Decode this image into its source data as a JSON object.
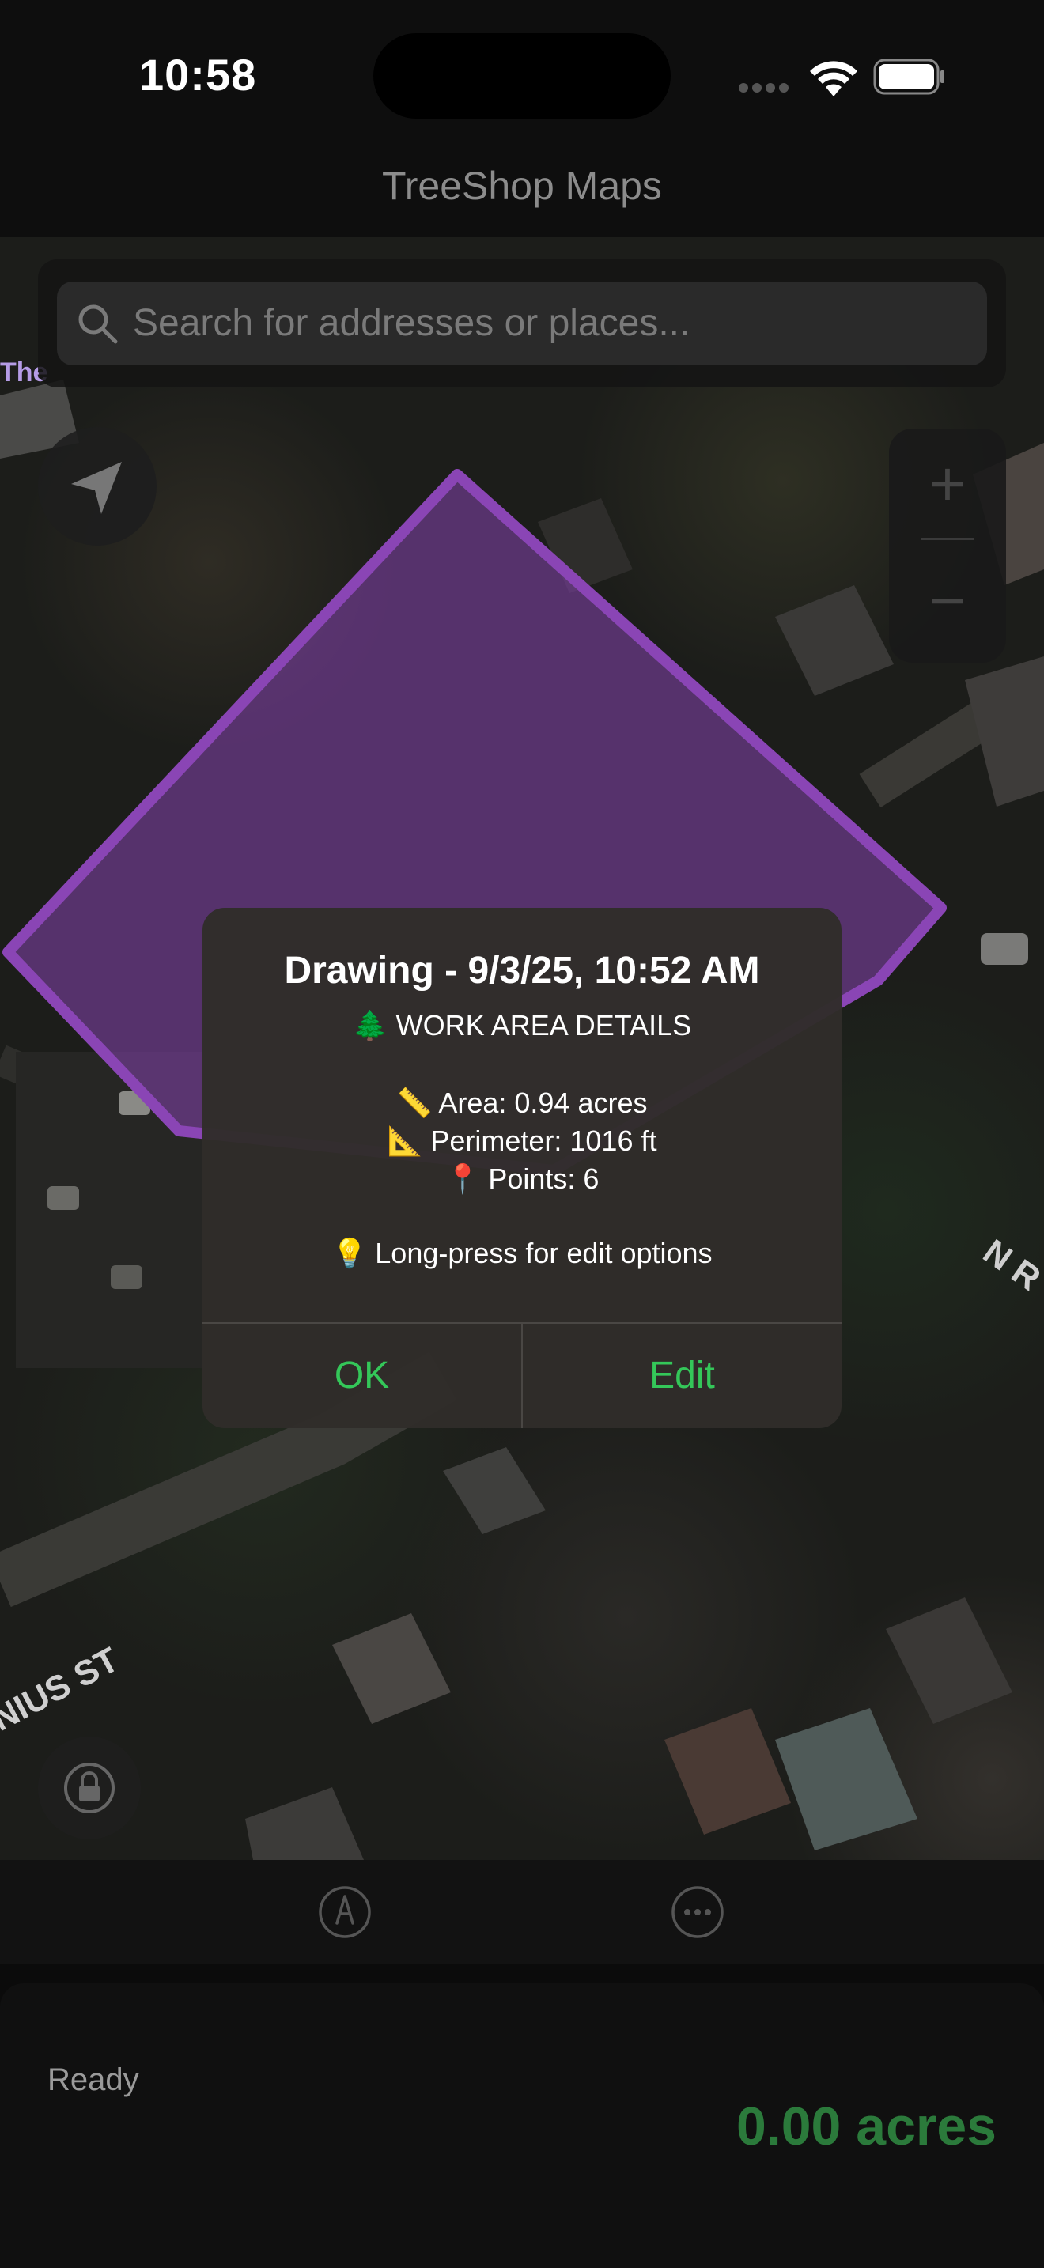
{
  "status_bar": {
    "time": "10:58"
  },
  "nav": {
    "title": "TreeShop Maps"
  },
  "search": {
    "placeholder": "Search for addresses or places..."
  },
  "map": {
    "labels": {
      "top_left": "The",
      "street_left": "NIUS ST",
      "street_right": "N R"
    },
    "zoom_in": "+",
    "zoom_out": "−",
    "polygon_color": "#7a3fa0"
  },
  "alert": {
    "title": "Drawing - 9/3/25, 10:52 AM",
    "subtitle": "🌲 WORK AREA DETAILS",
    "area": "📏 Area: 0.94 acres",
    "perimeter": "📐 Perimeter: 1016 ft",
    "points": "📍 Points: 6",
    "tip": "💡 Long-press for edit options",
    "ok_label": "OK",
    "edit_label": "Edit"
  },
  "toolbar": {
    "tools": [
      "draw-tool",
      "more-tool"
    ]
  },
  "panel": {
    "status": "Ready",
    "acres": "0.00 acres"
  },
  "colors": {
    "accent": "#34c759",
    "acres": "#2b7a3b",
    "polygon": "#7a3fa0"
  }
}
